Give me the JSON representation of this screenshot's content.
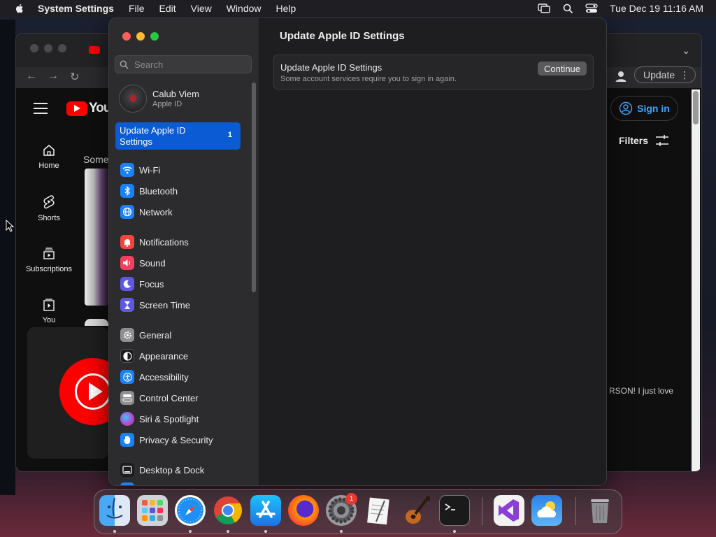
{
  "menubar": {
    "app_name": "System Settings",
    "items": [
      "File",
      "Edit",
      "View",
      "Window",
      "Help"
    ],
    "clock": "Tue Dec 19  11:16 AM"
  },
  "browser": {
    "youtube_logo_text": "You",
    "nav": [
      {
        "label": "Home",
        "icon": "home-icon"
      },
      {
        "label": "Shorts",
        "icon": "shorts-icon"
      },
      {
        "label": "Subscriptions",
        "icon": "subscriptions-icon"
      },
      {
        "label": "You",
        "icon": "you-icon"
      }
    ],
    "section_text": "Some",
    "update_label": "Update",
    "signin_label": "Sign in",
    "filters_label": "Filters",
    "comment_text": "RSON! I just love"
  },
  "settings": {
    "search_placeholder": "Search",
    "account": {
      "name": "Calub Viem",
      "subtitle": "Apple ID"
    },
    "selected": {
      "label": "Update Apple ID Settings",
      "badge": "1"
    },
    "groups": [
      [
        {
          "label": "Wi-Fi",
          "icon": "wifi-icon",
          "color": "#1a82f7"
        },
        {
          "label": "Bluetooth",
          "icon": "bluetooth-icon",
          "color": "#1a82f7"
        },
        {
          "label": "Network",
          "icon": "network-icon",
          "color": "#1a82f7"
        }
      ],
      [
        {
          "label": "Notifications",
          "icon": "notifications-icon",
          "color": "#f1453d"
        },
        {
          "label": "Sound",
          "icon": "sound-icon",
          "color": "#f0405e"
        },
        {
          "label": "Focus",
          "icon": "focus-icon",
          "color": "#5d5ae0"
        },
        {
          "label": "Screen Time",
          "icon": "screen-time-icon",
          "color": "#5d5ae0"
        }
      ],
      [
        {
          "label": "General",
          "icon": "general-icon",
          "color": "#8e8e93"
        },
        {
          "label": "Appearance",
          "icon": "appearance-icon",
          "color": "#1c1c1e"
        },
        {
          "label": "Accessibility",
          "icon": "accessibility-icon",
          "color": "#1a82f7"
        },
        {
          "label": "Control Center",
          "icon": "control-center-icon",
          "color": "#8e8e93"
        },
        {
          "label": "Siri & Spotlight",
          "icon": "siri-icon",
          "color": "#b04ad8"
        },
        {
          "label": "Privacy & Security",
          "icon": "privacy-icon",
          "color": "#1a82f7"
        }
      ],
      [
        {
          "label": "Desktop & Dock",
          "icon": "desktop-dock-icon",
          "color": "#1c1c1e"
        }
      ]
    ],
    "main": {
      "title": "Update Apple ID Settings",
      "card_title": "Update Apple ID Settings",
      "card_subtitle": "Some account services require you to sign in again.",
      "continue_label": "Continue"
    }
  },
  "dock": {
    "apps": [
      {
        "name": "Finder",
        "icon": "finder-icon",
        "running": true
      },
      {
        "name": "Launchpad",
        "icon": "launchpad-icon",
        "running": false
      },
      {
        "name": "Safari",
        "icon": "safari-icon",
        "running": true
      },
      {
        "name": "Chrome",
        "icon": "chrome-icon",
        "running": true
      },
      {
        "name": "App Store",
        "icon": "app-store-icon",
        "running": true
      },
      {
        "name": "Firefox",
        "icon": "firefox-icon",
        "running": false
      },
      {
        "name": "System Settings",
        "icon": "system-settings-icon",
        "running": true,
        "badge": "1"
      },
      {
        "name": "TextEdit",
        "icon": "textedit-icon",
        "running": false
      },
      {
        "name": "GarageBand",
        "icon": "garageband-icon",
        "running": false
      },
      {
        "name": "Terminal",
        "icon": "terminal-icon",
        "running": true
      },
      {
        "name": "Visual Studio",
        "icon": "visual-studio-icon",
        "running": false
      },
      {
        "name": "Weather",
        "icon": "weather-icon",
        "running": false
      },
      {
        "name": "Trash",
        "icon": "trash-icon",
        "running": false
      }
    ]
  }
}
